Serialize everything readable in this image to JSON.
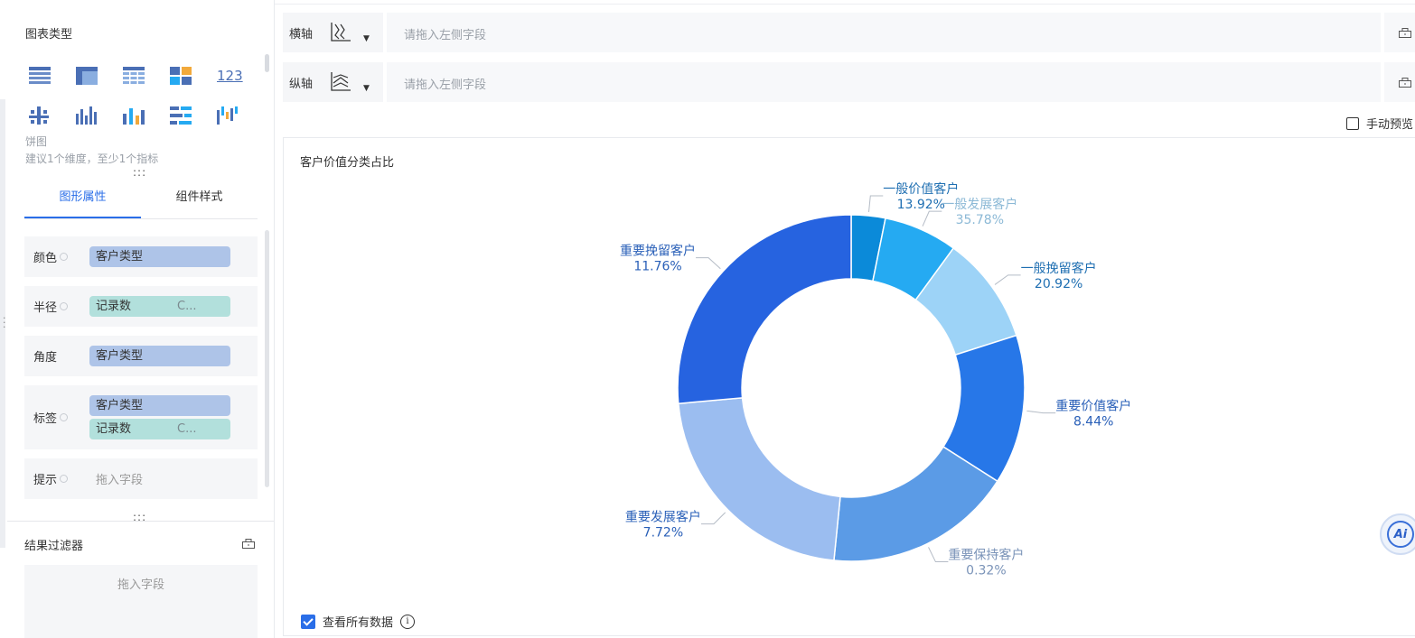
{
  "left_panel": {
    "chart_type_title": "图表类型",
    "chart_type_icons": [
      [
        "table-icon",
        "cross-table-icon",
        "detail-table-icon",
        "kpi-grid-icon",
        "number-123-icon"
      ],
      [
        "dot-matrix-icon",
        "grouped-bar-icon",
        "stacked-bar-icon",
        "horizontal-bar-icon",
        "waterfall-icon"
      ]
    ],
    "number_icon_text": "123",
    "selected_chart_name": "饼图",
    "chart_hint": "建议1个维度，至少1个指标",
    "grip": ":::",
    "tabs": [
      "图形属性",
      "组件样式"
    ],
    "properties": [
      {
        "label": "颜色",
        "pills": [
          {
            "text": "客户类型",
            "kind": "dim"
          }
        ]
      },
      {
        "label": "半径",
        "pills": [
          {
            "text": "记录数",
            "kind": "meas",
            "extra": "C..."
          }
        ]
      },
      {
        "label": "角度",
        "pills": [
          {
            "text": "客户类型",
            "kind": "dim"
          }
        ]
      },
      {
        "label": "标签",
        "pills": [
          {
            "text": "客户类型",
            "kind": "dim"
          },
          {
            "text": "记录数",
            "kind": "meas",
            "extra": "C..."
          }
        ]
      },
      {
        "label": "提示",
        "placeholder": "拖入字段"
      }
    ],
    "filter_title": "结果过滤器",
    "filter_placeholder": "拖入字段"
  },
  "axes": {
    "x_label": "横轴",
    "y_label": "纵轴",
    "placeholder": "请拖入左侧字段"
  },
  "manual_preview_label": "手动预览",
  "chart_card_title": "客户价值分类占比",
  "view_all_label": "查看所有数据",
  "ai_badge": "Ai",
  "colors": {
    "accent": "#2a6ee8",
    "dimension_pill": "#aec4e8",
    "measure_pill": "#b2e0dc"
  },
  "chart_data": {
    "type": "pie",
    "inner_radius_ratio": 0.63,
    "labels": [
      "一般价值客户",
      "一般发展客户",
      "一般挽留客户",
      "重要价值客户",
      "重要保持客户",
      "重要发展客户",
      "重要挽留客户"
    ],
    "percent_labels": [
      "13.92%",
      "35.78%",
      "20.92%",
      "8.44%",
      "0.32%",
      "7.72%",
      "11.76%"
    ],
    "values": [
      3.0,
      6.5,
      9.5,
      13.2,
      16.6,
      20.8,
      25.0
    ],
    "colors": [
      "#0b8ad9",
      "#25aaf2",
      "#9dd3f7",
      "#2777e8",
      "#5b9be6",
      "#9bbdf0",
      "#2663e0",
      "#4d7ef6"
    ],
    "label_colors": [
      "#1f6fb2",
      "#8cb9d6",
      "#1f6fb2",
      "#2a60b8",
      "#7a93b8",
      "#2a60b8",
      "#2a60b8"
    ]
  }
}
